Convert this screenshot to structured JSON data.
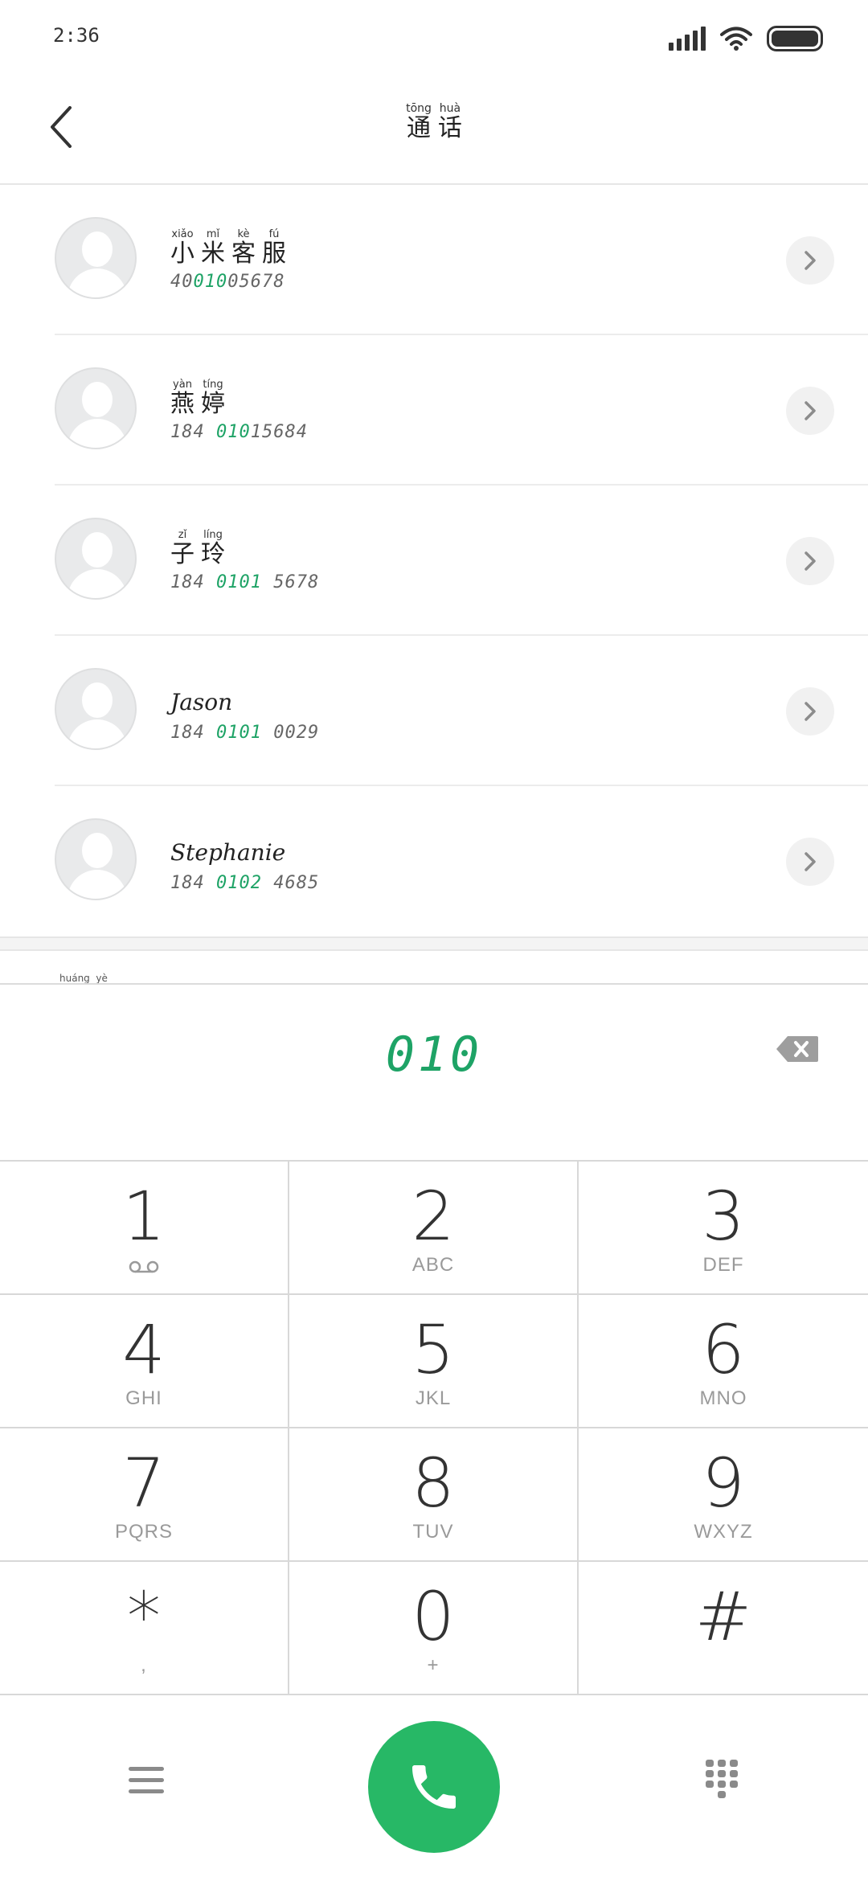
{
  "status_bar": {
    "time": "2:36"
  },
  "header": {
    "title": [
      {
        "pinyin": "tōng",
        "hanzi": "通"
      },
      {
        "pinyin": "huà",
        "hanzi": "话"
      }
    ]
  },
  "contacts": [
    {
      "name_ruby": [
        {
          "pinyin": "xiǎo",
          "hanzi": "小"
        },
        {
          "pinyin": "mǐ",
          "hanzi": "米"
        },
        {
          "pinyin": "kè",
          "hanzi": "客"
        },
        {
          "pinyin": "fú",
          "hanzi": "服"
        }
      ],
      "number_pre": "40",
      "number_hl": "010",
      "number_post": "05678"
    },
    {
      "name_ruby": [
        {
          "pinyin": "yàn",
          "hanzi": "燕"
        },
        {
          "pinyin": "tíng",
          "hanzi": "婷"
        }
      ],
      "number_pre": "184 ",
      "number_hl": "010",
      "number_post": "15684"
    },
    {
      "name_ruby": [
        {
          "pinyin": "zǐ",
          "hanzi": "子"
        },
        {
          "pinyin": "líng",
          "hanzi": "玲"
        }
      ],
      "number_pre": "184 ",
      "number_hl": "0101",
      "number_post": " 5678"
    },
    {
      "name": "Jason",
      "number_pre": "184 ",
      "number_hl": "0101",
      "number_post": " 0029"
    },
    {
      "name": "Stephanie",
      "number_pre": "184 ",
      "number_hl": "0102",
      "number_post": " 4685"
    }
  ],
  "yellow_pages_label": "huáng  yè",
  "dialer": {
    "dialed": "010"
  },
  "keypad": [
    {
      "digit": "1",
      "letters": "",
      "icon": "voicemail-icon"
    },
    {
      "digit": "2",
      "letters": "ABC"
    },
    {
      "digit": "3",
      "letters": "DEF"
    },
    {
      "digit": "4",
      "letters": "GHI"
    },
    {
      "digit": "5",
      "letters": "JKL"
    },
    {
      "digit": "6",
      "letters": "MNO"
    },
    {
      "digit": "7",
      "letters": "PQRS"
    },
    {
      "digit": "8",
      "letters": "TUV"
    },
    {
      "digit": "9",
      "letters": "WXYZ"
    },
    {
      "digit": "*",
      "letters": ","
    },
    {
      "digit": "0",
      "letters": "+"
    },
    {
      "digit": "#",
      "letters": ""
    }
  ],
  "colors": {
    "accent": "#27b866",
    "highlight_text": "#1ea366"
  }
}
